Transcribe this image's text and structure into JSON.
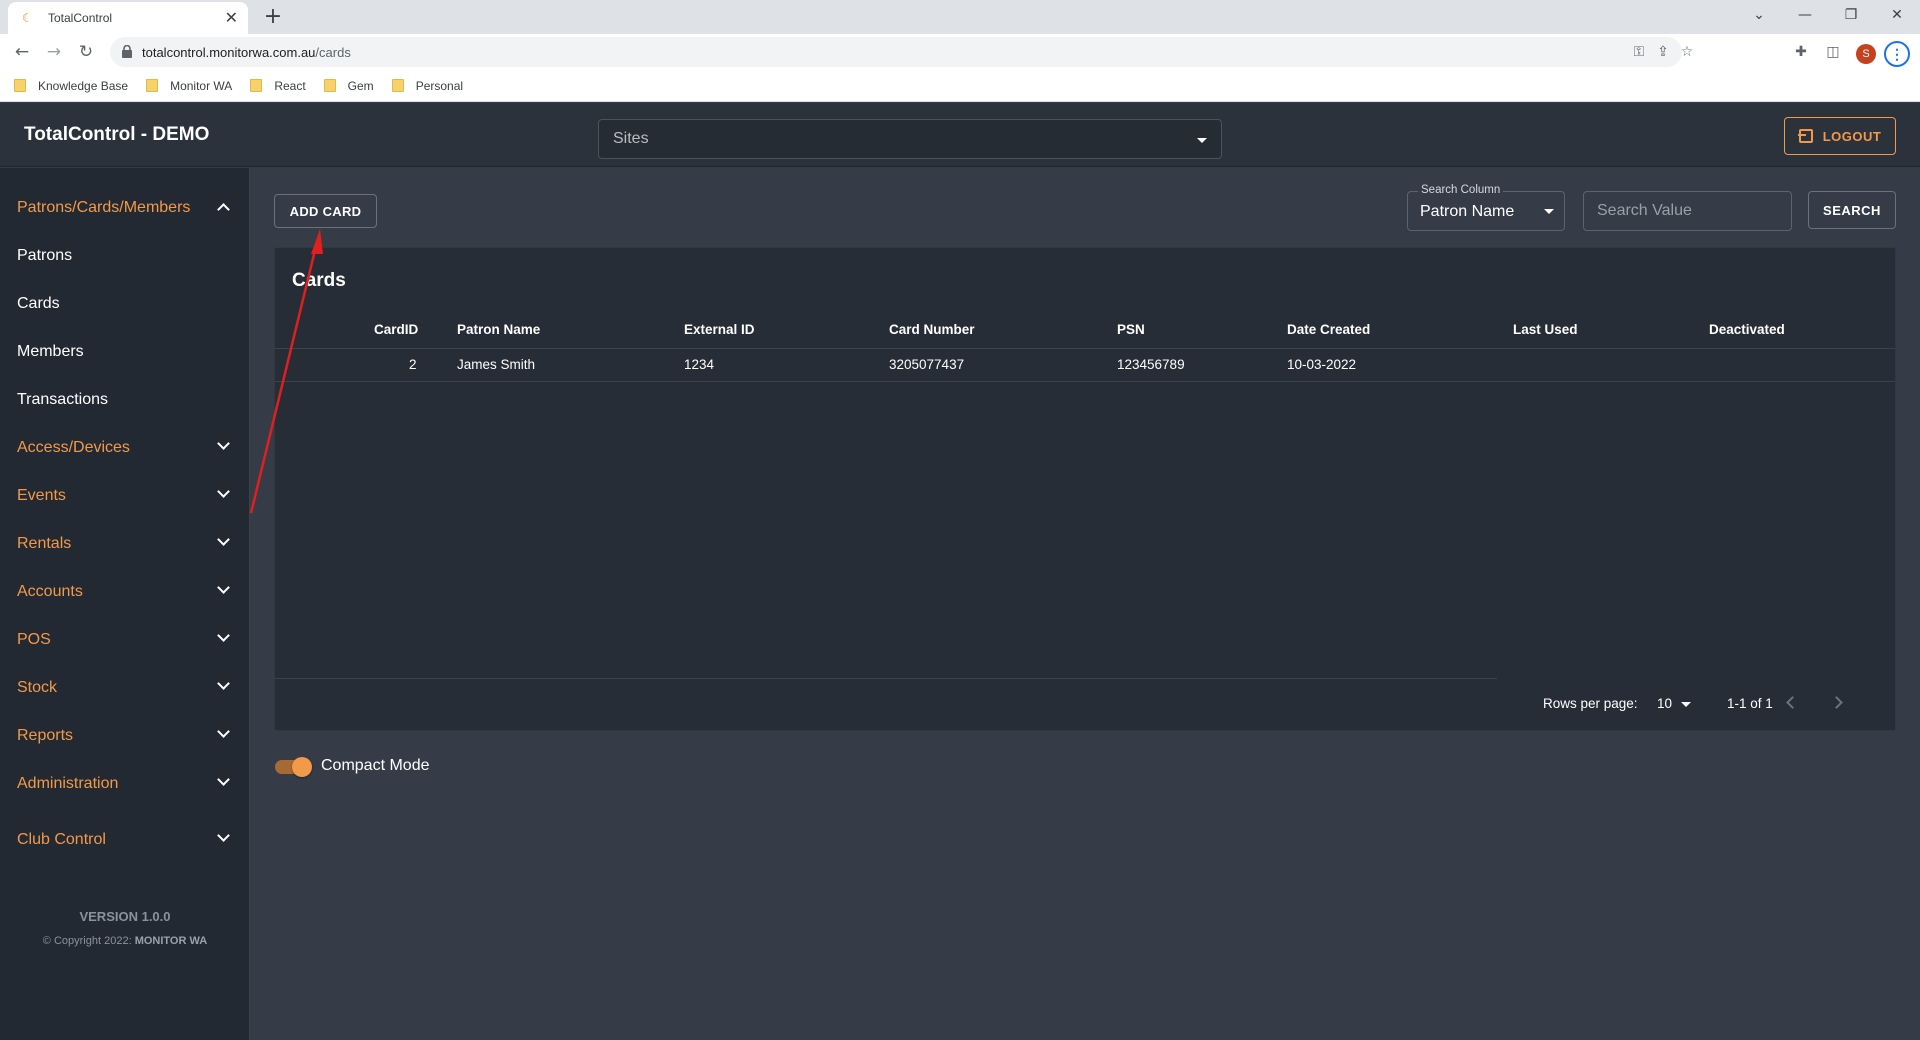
{
  "browser": {
    "tab_title": "TotalControl",
    "tab_close": "✕",
    "new_tab": "+",
    "url_host": "totalcontrol.monitorwa.com.au",
    "url_path": "/cards",
    "profile_initial": "S",
    "bookmarks": [
      "Knowledge Base",
      "Monitor WA",
      "React",
      "Gem",
      "Personal"
    ]
  },
  "header": {
    "title": "TotalControl - DEMO",
    "sites_label": "Sites",
    "logout_label": "LOGOUT"
  },
  "sidebar": {
    "items": [
      {
        "label": "Patrons/Cards/Members"
      },
      {
        "label": "Patrons"
      },
      {
        "label": "Cards"
      },
      {
        "label": "Members"
      },
      {
        "label": "Transactions"
      },
      {
        "label": "Access/Devices"
      },
      {
        "label": "Events"
      },
      {
        "label": "Rentals"
      },
      {
        "label": "Accounts"
      },
      {
        "label": "POS"
      },
      {
        "label": "Stock"
      },
      {
        "label": "Reports"
      },
      {
        "label": "Administration"
      },
      {
        "label": "Club Control"
      }
    ],
    "version": "VERSION 1.0.0",
    "copyright_prefix": "© Copyright 2022:",
    "copyright_org": "MONITOR WA"
  },
  "toolbar": {
    "add_card_label": "ADD CARD",
    "search_column_label": "Search Column",
    "search_column_value": "Patron Name",
    "search_value_placeholder": "Search Value",
    "search_button_label": "SEARCH"
  },
  "table": {
    "title": "Cards",
    "columns": [
      "CardID",
      "Patron Name",
      "External ID",
      "Card Number",
      "PSN",
      "Date Created",
      "Last Used",
      "Deactivated"
    ],
    "rows": [
      [
        "2",
        "James Smith",
        "1234",
        "3205077437",
        "123456789",
        "10-03-2022",
        "",
        ""
      ]
    ]
  },
  "pagination": {
    "rows_per_page_label": "Rows per page:",
    "rows_per_page_value": "10",
    "range": "1-1 of 1"
  },
  "compact_mode": {
    "label": "Compact Mode",
    "enabled": true
  },
  "colors": {
    "accent": "#f2994a",
    "sidebar_bg": "#222932",
    "content_bg": "#353c47",
    "annotation_arrow": "#e01f1f"
  }
}
